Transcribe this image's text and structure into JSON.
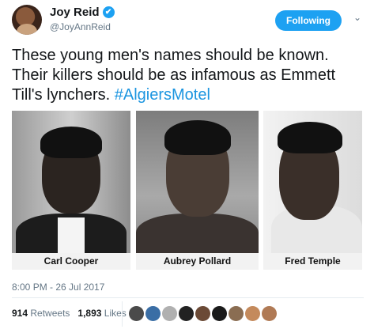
{
  "author": {
    "display_name": "Joy Reid",
    "handle": "@JoyAnnReid",
    "verified_icon": "✔"
  },
  "follow_button": {
    "label": "Following"
  },
  "menu_caret": "⌄",
  "tweet": {
    "text": "These young men's names should be known. Their killers should be as infamous as Emmett Till's lynchers. ",
    "hashtag": "#AlgiersMotel"
  },
  "media": {
    "photos": [
      {
        "caption": "Carl Cooper"
      },
      {
        "caption": "Aubrey Pollard"
      },
      {
        "caption": "Fred Temple"
      }
    ]
  },
  "timestamp": "8:00 PM - 26 Jul 2017",
  "stats": {
    "retweets_count": "914",
    "retweets_label": "Retweets",
    "likes_count": "1,893",
    "likes_label": "Likes"
  },
  "likers": {
    "colors": [
      "#4a4a4a",
      "#3a6ea5",
      "#b0b0b0",
      "#222222",
      "#6b4a36",
      "#1a1a1a",
      "#8a6d52",
      "#c48a5c",
      "#b07a55"
    ]
  }
}
